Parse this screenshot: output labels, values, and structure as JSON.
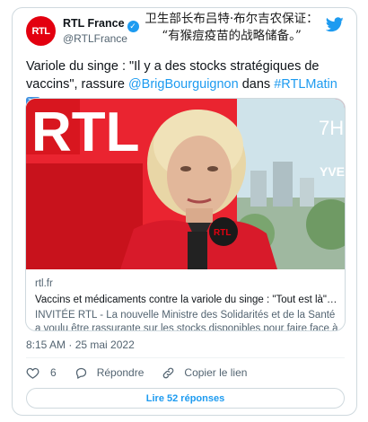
{
  "author": {
    "name": "RTL France",
    "handle": "@RTLFrance",
    "avatar_text": "RTL"
  },
  "overlay_caption": {
    "line1": "卫生部长布吕特·布尔吉农保证：",
    "line2": "“有猴痘疫苗的战略储备。”"
  },
  "tweet": {
    "text_part1": "Variole du singe : \"Il y a des stocks stratégiques de vaccins\", rassure ",
    "mention": "@BrigBourguignon",
    "text_part2": " dans ",
    "hashtag": "#RTLMatin",
    "arrow": "⤵"
  },
  "card": {
    "logo_text": "RTL",
    "screen_time": "7H",
    "screen_label": "YVE",
    "mic_logo": "RTL",
    "domain": "rtl.fr",
    "title": "Vaccins et médicaments contre la variole du singe : \"Tout est là\", dit ...",
    "description": "INVITÉE RTL - La nouvelle Ministre des Solidarités et de la Santé a voulu être rassurante sur les stocks disponibles pour faire face à ce ..."
  },
  "timestamp": "8:15 AM · 25 mai 2022",
  "actions": {
    "like_count": "6",
    "reply_label": "Répondre",
    "copy_label": "Copier le lien"
  },
  "replies_button": "Lire 52 réponses",
  "colors": {
    "accent": "#1d9bf0",
    "rtl_red": "#e3000f"
  }
}
